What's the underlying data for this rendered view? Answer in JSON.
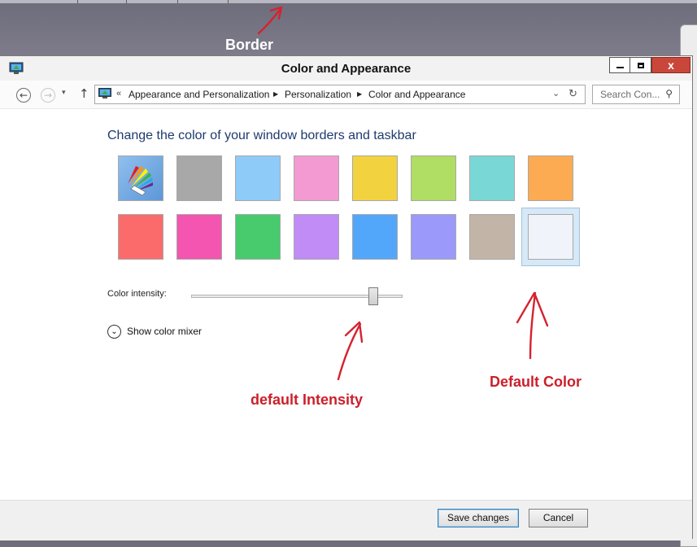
{
  "window": {
    "title": "Color and Appearance",
    "close_label": "x"
  },
  "nav": {
    "back_glyph": "←",
    "forward_glyph": "→",
    "recent_glyph": "▾",
    "up_glyph": "↑",
    "crumb_lead": "«",
    "breadcrumbs": [
      "Appearance and Personalization",
      "Personalization",
      "Color and Appearance"
    ],
    "dropdown_glyph": "⌄",
    "refresh_glyph": "↻",
    "search_placeholder": "Search Con..."
  },
  "main": {
    "heading": "Change the color of your window borders and taskbar",
    "swatches": [
      {
        "name": "automatic",
        "color": "#6aa3e0"
      },
      {
        "name": "gray",
        "color": "#a8a8a8"
      },
      {
        "name": "light-blue",
        "color": "#8fcbf8"
      },
      {
        "name": "pink",
        "color": "#f49ad3"
      },
      {
        "name": "yellow",
        "color": "#f3d23f"
      },
      {
        "name": "green",
        "color": "#b0dd63"
      },
      {
        "name": "teal",
        "color": "#79d8d6"
      },
      {
        "name": "orange",
        "color": "#fdab52"
      },
      {
        "name": "salmon",
        "color": "#fc6b6b"
      },
      {
        "name": "magenta",
        "color": "#f355b0"
      },
      {
        "name": "emerald",
        "color": "#47cb6d"
      },
      {
        "name": "violet",
        "color": "#c18cf6"
      },
      {
        "name": "blue",
        "color": "#52a7fb"
      },
      {
        "name": "periwinkle",
        "color": "#9b9afb"
      },
      {
        "name": "taupe",
        "color": "#c3b4a8"
      },
      {
        "name": "white",
        "color": "#f0f4fa",
        "selected": true
      }
    ],
    "intensity_label": "Color intensity:",
    "intensity_value": 0.86,
    "mixer_label": "Show color mixer"
  },
  "footer": {
    "save_label": "Save changes",
    "cancel_label": "Cancel"
  },
  "annotations": {
    "border": "Border",
    "intensity": "default Intensity",
    "default_color": "Default Color",
    "color": "#cc1f2a"
  }
}
